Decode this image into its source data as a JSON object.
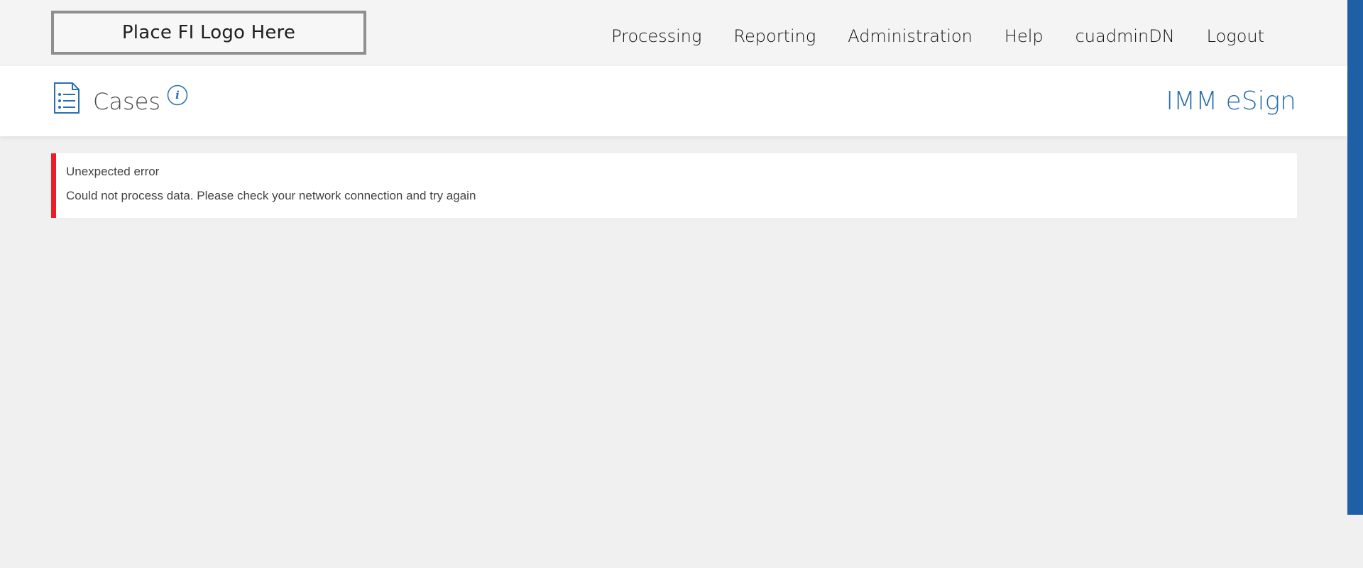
{
  "header": {
    "logo_text": "Place FI Logo Here",
    "nav": [
      {
        "label": "Processing"
      },
      {
        "label": "Reporting"
      },
      {
        "label": "Administration"
      },
      {
        "label": "Help"
      },
      {
        "label": "cuadminDN"
      },
      {
        "label": "Logout"
      }
    ]
  },
  "subheader": {
    "page_title": "Cases",
    "page_icon": "list-document-icon",
    "info_icon": "info-icon",
    "brand": "IMM eSign"
  },
  "alert": {
    "title": "Unexpected error",
    "message": "Could not process data. Please check your network connection and try again",
    "accent_color": "#ee1c25"
  },
  "colors": {
    "brand_blue": "#2a6fb0",
    "scroll_bar": "#1f5fa6"
  }
}
